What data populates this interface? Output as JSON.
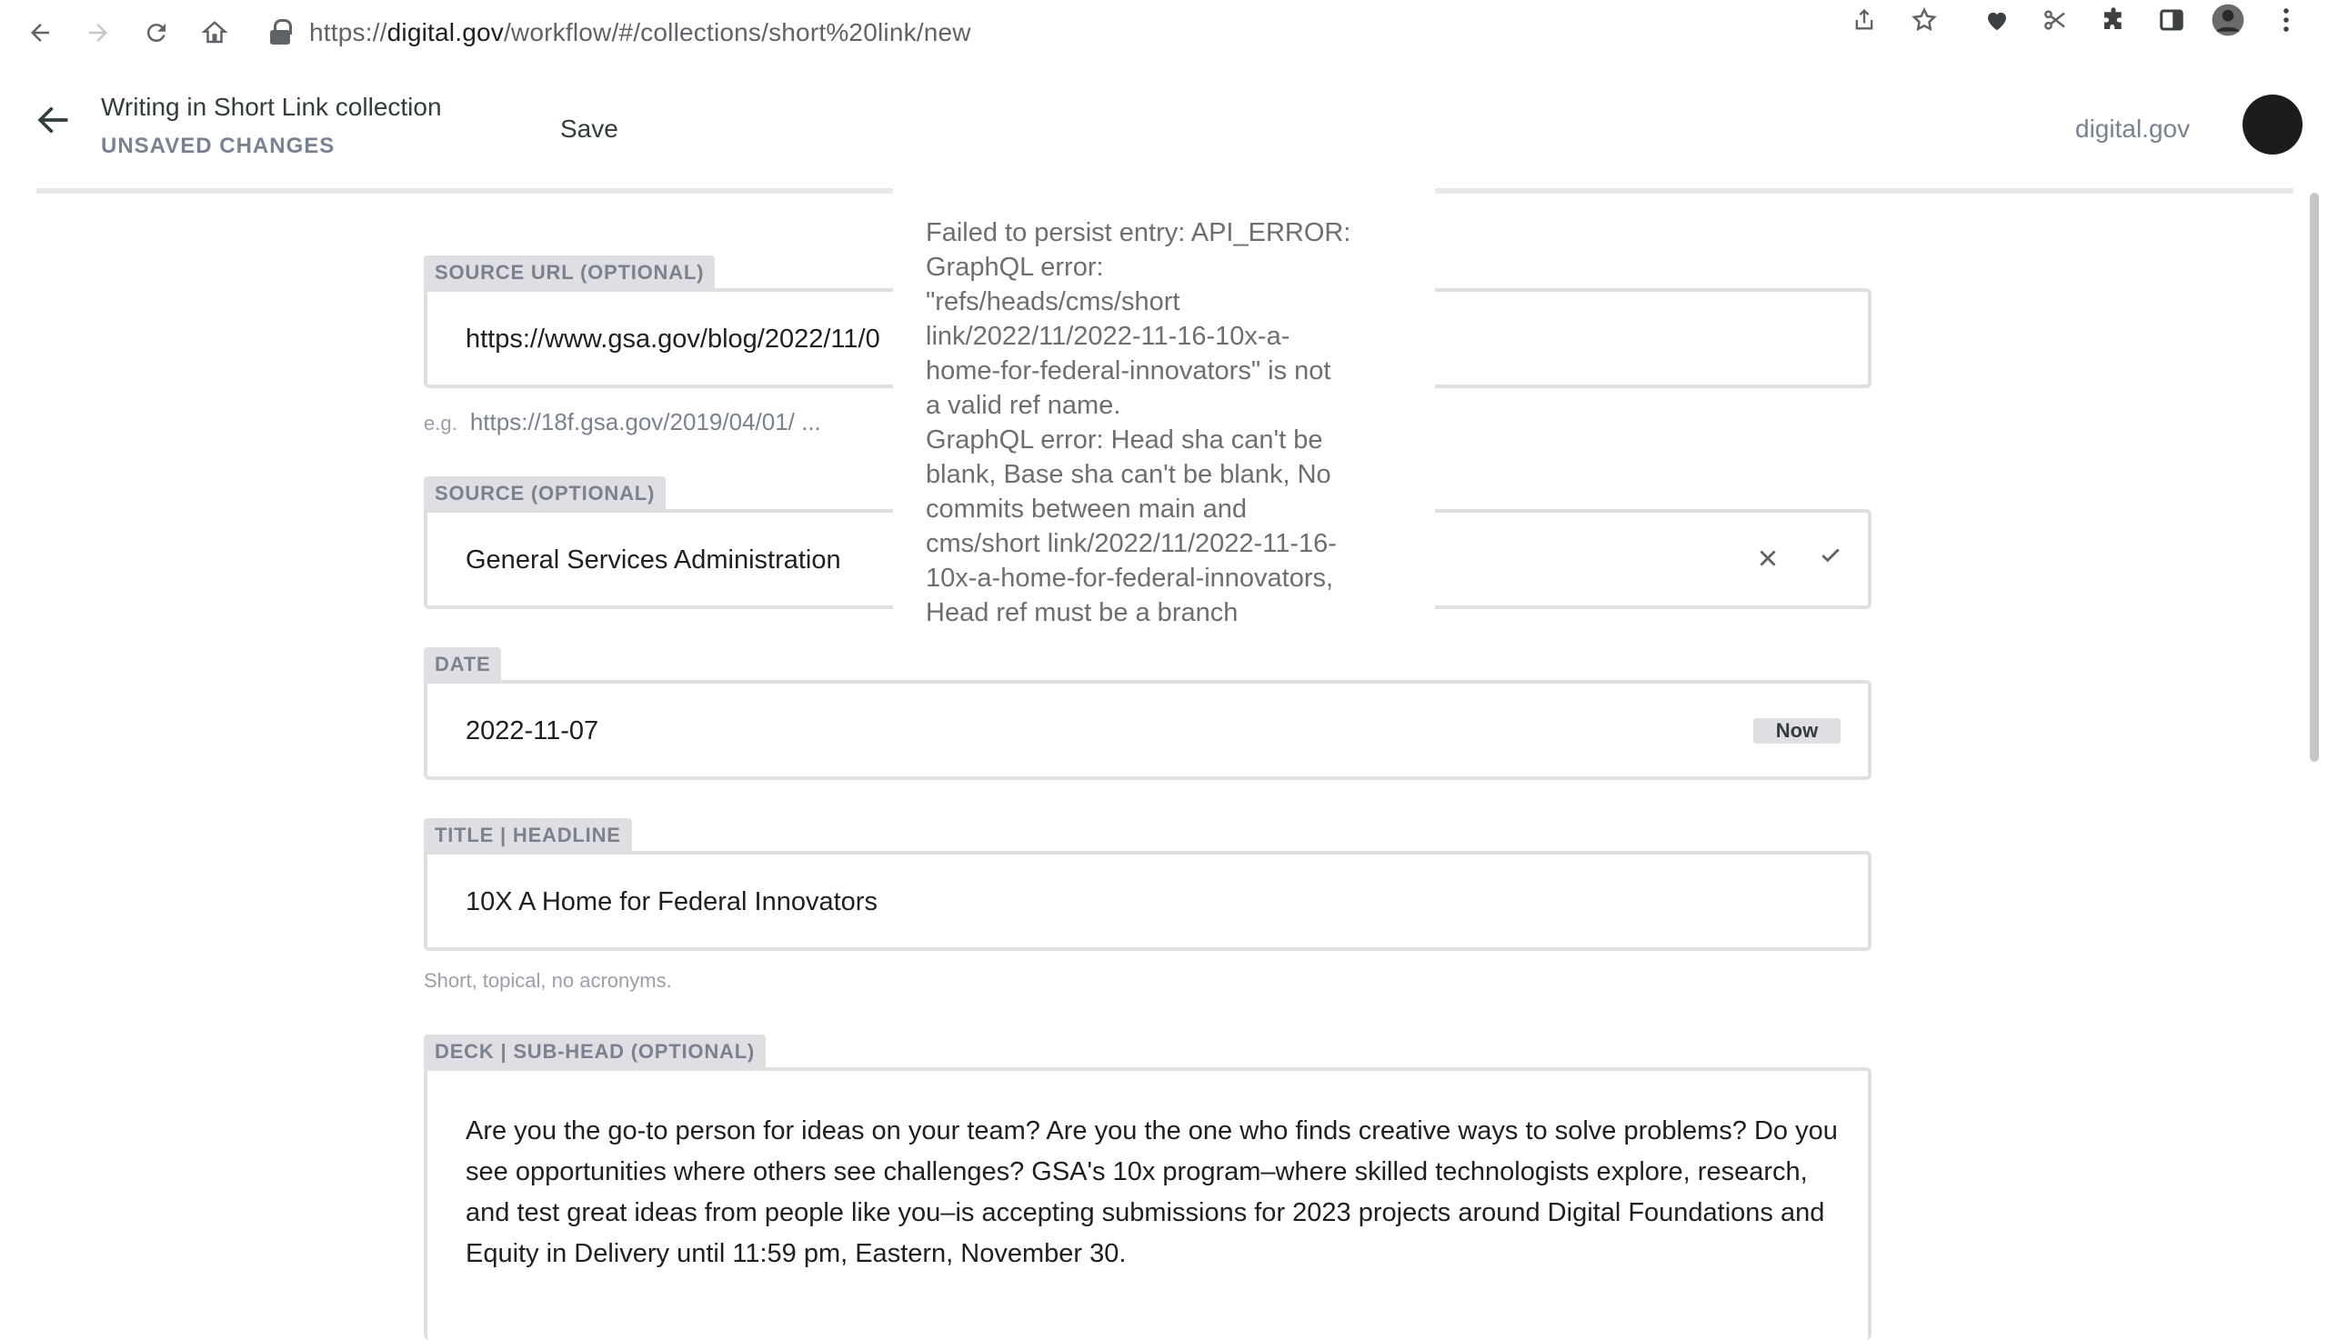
{
  "browser": {
    "url_scheme": "https://",
    "url_host": "digital.gov",
    "url_path": "/workflow/#/collections/short%20link/new",
    "icons": [
      "back-icon",
      "forward-icon",
      "reload-icon",
      "home-icon",
      "lock-icon",
      "share-icon",
      "bookmark-star-icon",
      "extension-heart-icon",
      "scissors-icon",
      "puzzle-icon",
      "side-panel-icon",
      "profile-icon",
      "menu-dots-icon"
    ]
  },
  "header": {
    "title": "Writing in Short Link collection",
    "status": "UNSAVED CHANGES",
    "save_label": "Save",
    "site_link": "digital.gov"
  },
  "fields": {
    "source_url": {
      "label": "SOURCE URL (OPTIONAL)",
      "value": "https://www.gsa.gov/blog/2022/11/0",
      "hint_prefix": "e.g.",
      "hint": "https://18f.gsa.gov/2019/04/01/ ..."
    },
    "source": {
      "label": "SOURCE (OPTIONAL)",
      "value": "General Services Administration"
    },
    "date": {
      "label": "DATE",
      "value": "2022-11-07",
      "now_label": "Now"
    },
    "title": {
      "label": "TITLE | HEADLINE",
      "value": "10X A Home for Federal Innovators",
      "hint": "Short, topical, no acronyms."
    },
    "deck": {
      "label": "DECK | SUB-HEAD (OPTIONAL)",
      "value": "Are you the go-to person for ideas on your team? Are you the one who finds creative ways to solve problems? Do you see opportunities where others see challenges? GSA's 10x program–where skilled technologists explore, research, and test great ideas from people like you–is accepting submissions for 2023 projects around Digital Foundations and Equity in Delivery until 11:59 pm, Eastern, November 30."
    }
  },
  "error": {
    "lines": [
      "Failed to persist entry: API_ERROR:",
      "GraphQL error:",
      "\"refs/heads/cms/short",
      "link/2022/11/2022-11-16-10x-a-",
      "home-for-federal-innovators\" is not",
      "a valid ref name.",
      "GraphQL error: Head sha can't be",
      "blank, Base sha can't be blank, No",
      "commits between main and",
      "cms/short link/2022/11/2022-11-16-",
      "10x-a-home-for-federal-innovators,",
      "Head ref must be a branch"
    ]
  }
}
